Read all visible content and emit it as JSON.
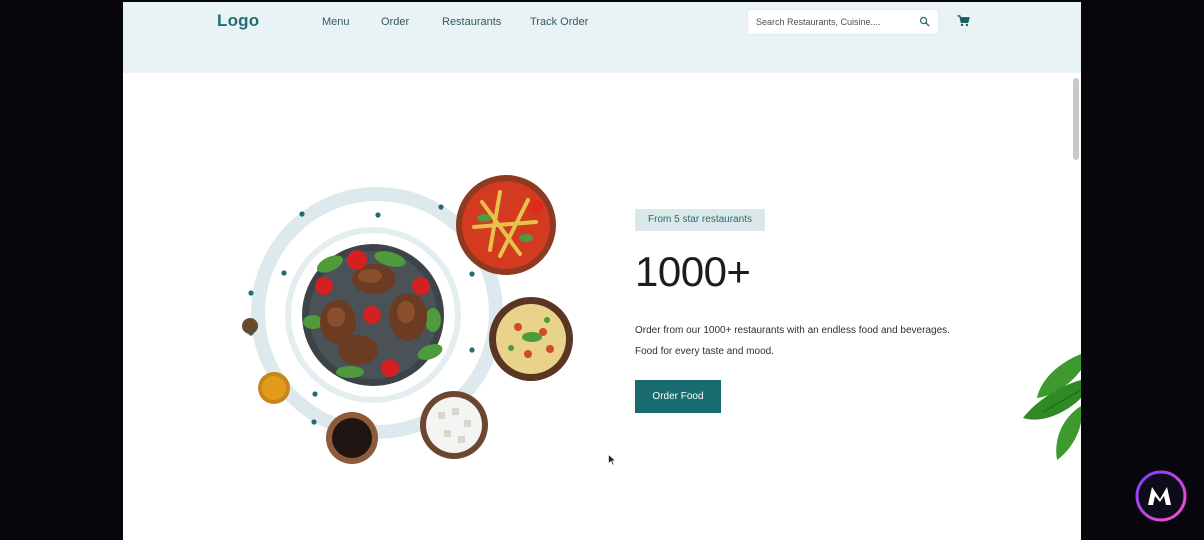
{
  "navbar": {
    "logo": "Logo",
    "links": [
      "Menu",
      "Order",
      "Restaurants",
      "Track Order"
    ],
    "search_placeholder": "Search Restaurants, Cuisine...."
  },
  "hero": {
    "badge": "From 5 star restaurants",
    "headline": "1000+",
    "description_line1": "Order from our 1000+ restaurants with an endless food and beverages.",
    "description_line2": "Food for every taste and mood.",
    "cta_label": "Order Food"
  },
  "icons": {
    "search": "search-icon",
    "cart": "cart-icon"
  },
  "colors": {
    "brand": "#186b6e",
    "navbar_bg": "#e9f2f5",
    "badge_bg": "#dbe8ea"
  }
}
